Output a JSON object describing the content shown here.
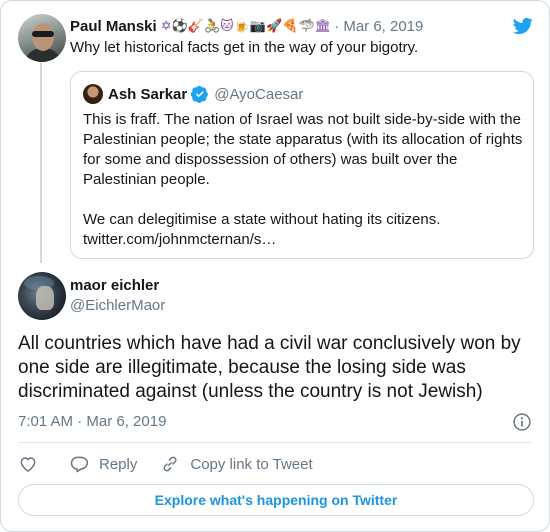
{
  "parent_tweet": {
    "author_name": "Paul Manski",
    "name_emojis": "✡⚽🎸🚴🐱🍺📷🚀🍕🦈🏛",
    "date": "· Mar 6, 2019",
    "text": "Why let historical facts get in the way of your bigotry.",
    "quoted": {
      "author_name": "Ash Sarkar",
      "handle": "@AyoCaesar",
      "text": "This is fraff. The nation of Israel was not built side-by-side with the Palestinian people; the state apparatus (with its allocation of rights for some and dispossession of others) was built over the Palestinian people.\n\nWe can delegitimise a state without hating its citizens.\ntwitter.com/johnmcternan/s…"
    }
  },
  "tweet": {
    "author_name": "maor eichler",
    "handle": "@EichlerMaor",
    "text": "All countries which have had a civil war conclusively won by one side are illegitimate, because the losing side was discriminated against (unless the country is not Jewish)",
    "timestamp": "7:01 AM · Mar 6, 2019"
  },
  "actions": {
    "reply_label": "Reply",
    "copy_link_label": "Copy link to Tweet"
  },
  "explore_label": "Explore what's happening on Twitter",
  "colors": {
    "brand_blue": "#1da1f2",
    "link_blue": "#1b95e0",
    "secondary_text": "#657786",
    "border": "#cfd9de"
  },
  "icons": [
    "twitter-bird-icon",
    "verified-badge-icon",
    "info-icon",
    "heart-icon",
    "reply-icon",
    "link-icon"
  ]
}
